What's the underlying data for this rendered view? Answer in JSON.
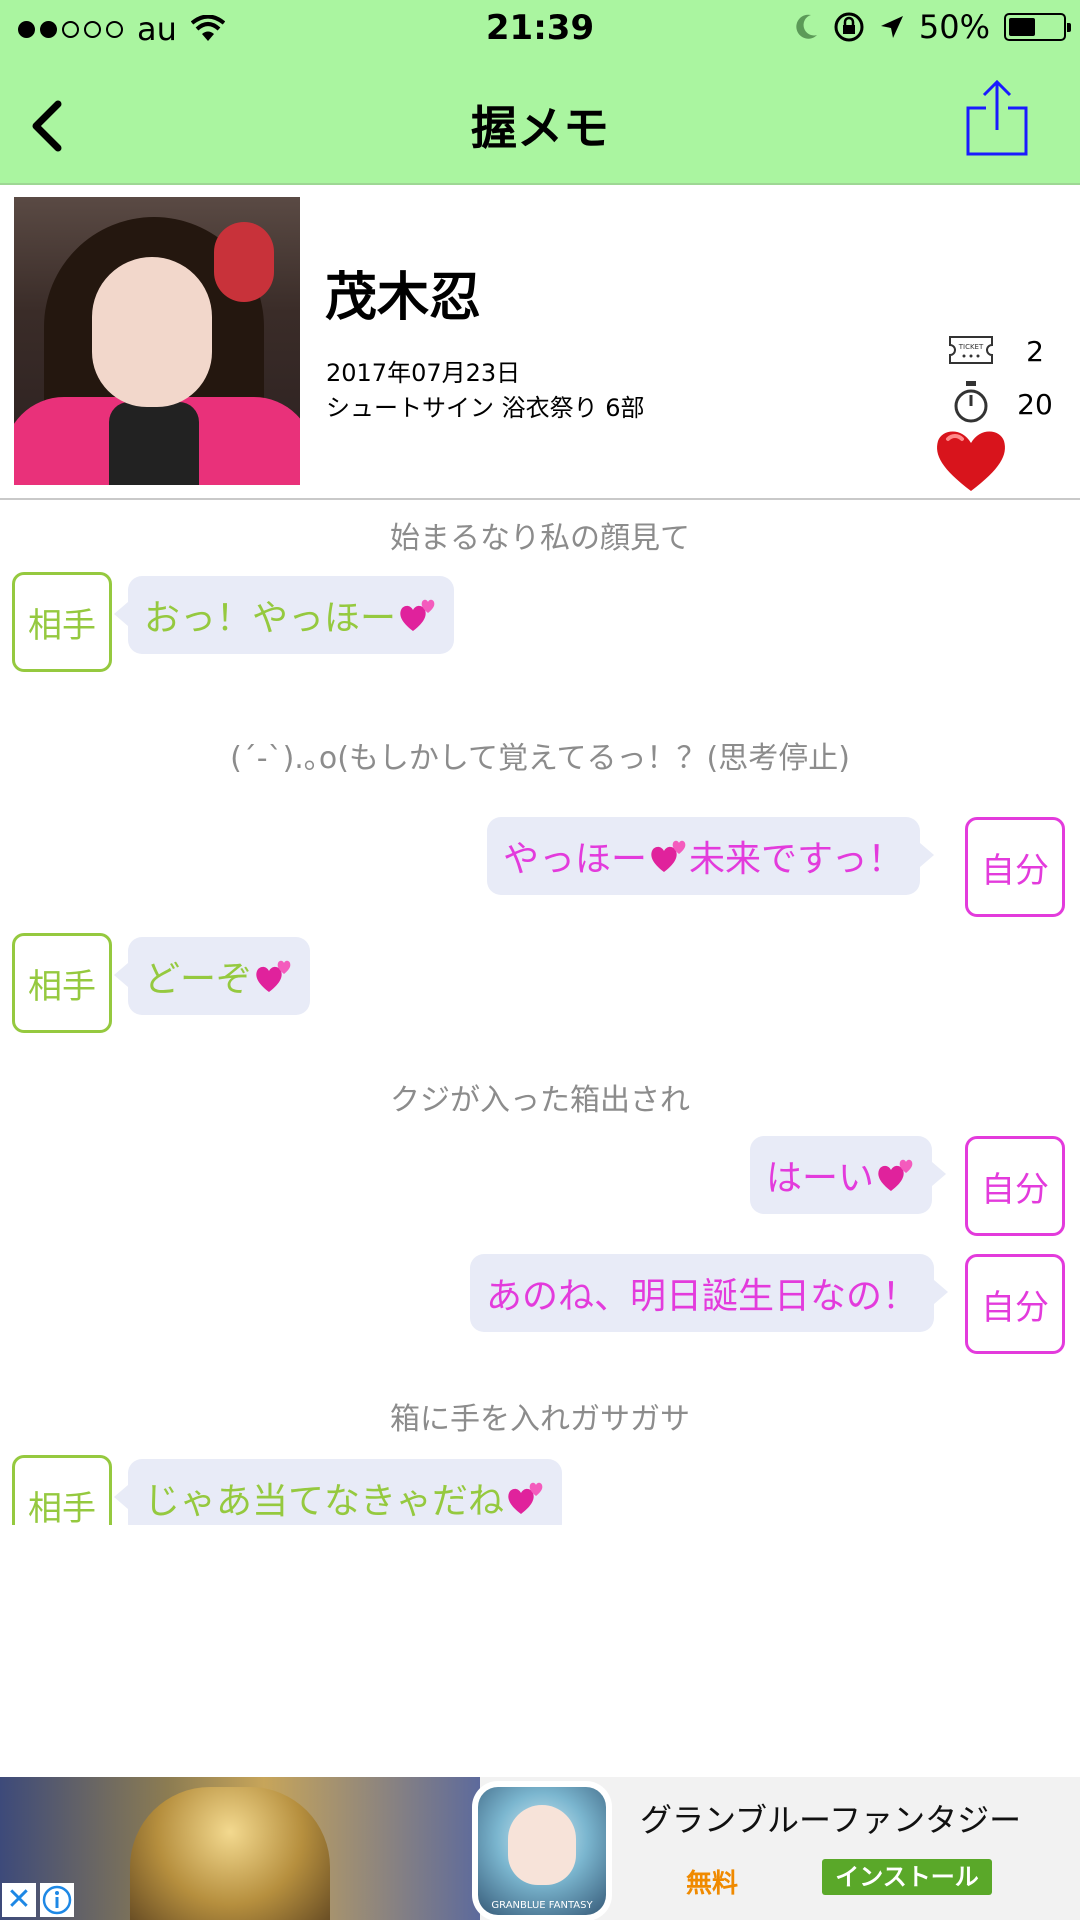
{
  "status_bar": {
    "carrier": "au",
    "signal_bars_filled": 2,
    "signal_bars_total": 5,
    "time": "21:39",
    "battery": "50%",
    "battery_level": 0.5
  },
  "nav": {
    "title": "握メモ"
  },
  "profile": {
    "name": "茂木忍",
    "date": "2017年07月23日",
    "event": "シュートサイン 浴衣祭り 6部",
    "tickets": "2",
    "seconds": "20",
    "ticket_icon_text": "TICKET"
  },
  "chat": {
    "other_tag": "相手",
    "self_tag": "自分",
    "notes": [
      "始まるなり私の顔見て",
      "(´-`).｡o(もしかして覚えてるっ！？(思考停止)",
      "クジが入った箱出され",
      "箱に手を入れガサガサ"
    ],
    "messages": [
      {
        "side": "other",
        "text": "おっ！やっほー"
      },
      {
        "side": "self",
        "text": "やっほー",
        "text_after": "未来ですっ！"
      },
      {
        "side": "other",
        "text": "どーぞ"
      },
      {
        "side": "self",
        "text": "はーい"
      },
      {
        "side": "self",
        "text": "あのね、明日誕生日なの！"
      },
      {
        "side": "other",
        "text": "じゃあ当てなきゃだね"
      }
    ]
  },
  "ad": {
    "app_name": "グランブルーファンタジー",
    "price": "無料",
    "install": "インストール",
    "close_symbol": "✕",
    "icon_label": "GRANBLUE FANTASY",
    "accent": "#5aa829"
  },
  "colors": {
    "nav_bg": "#aaf5a0",
    "other": "#95c93f",
    "self": "#e33bdc",
    "bubble_bg": "#e8ebf7",
    "note": "#8c8c8c"
  }
}
